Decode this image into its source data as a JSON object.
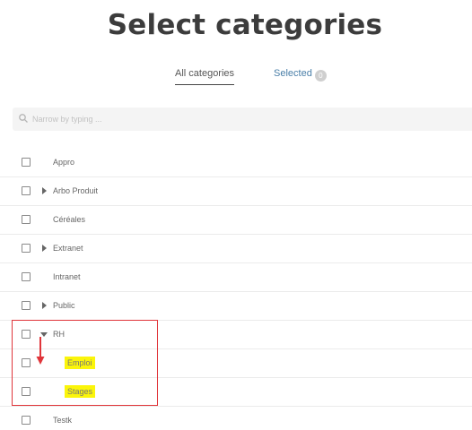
{
  "page": {
    "title": "Select categories"
  },
  "tabs": {
    "all_label": "All categories",
    "selected_label": "Selected",
    "selected_count": "0"
  },
  "search": {
    "placeholder": "Narrow by typing ..."
  },
  "categories": [
    {
      "label": "Appro",
      "has_children": false
    },
    {
      "label": "Arbo Produit",
      "has_children": true,
      "expanded": false
    },
    {
      "label": "Céréales",
      "has_children": false
    },
    {
      "label": "Extranet",
      "has_children": true,
      "expanded": false
    },
    {
      "label": "Intranet",
      "has_children": false
    },
    {
      "label": "Public",
      "has_children": true,
      "expanded": false
    },
    {
      "label": "RH",
      "has_children": true,
      "expanded": true,
      "children": [
        {
          "label": "Emploi",
          "highlighted": true
        },
        {
          "label": "Stages",
          "highlighted": true
        }
      ]
    },
    {
      "label": "Testk",
      "has_children": false
    }
  ],
  "colors": {
    "accent": "#4a7fa8",
    "highlight": "#fbf50a",
    "annotation_red": "#e0353a"
  }
}
